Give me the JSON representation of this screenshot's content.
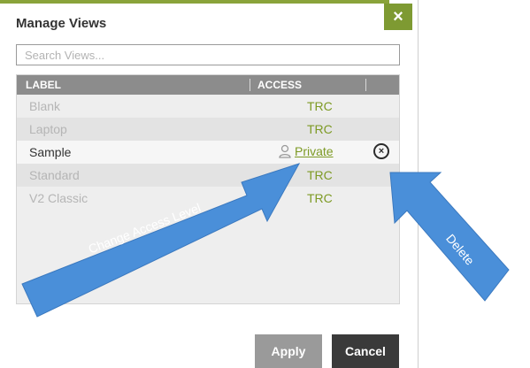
{
  "dialog": {
    "title": "Manage Views",
    "close_label": "×",
    "search_placeholder": "Search Views..."
  },
  "table": {
    "columns": [
      "LABEL",
      "ACCESS"
    ],
    "rows": [
      {
        "label": "Blank",
        "access": "TRC"
      },
      {
        "label": "Laptop",
        "access": "TRC"
      },
      {
        "label": "Sample",
        "access": "Private",
        "selected": true
      },
      {
        "label": "Standard",
        "access": "TRC"
      },
      {
        "label": "V2 Classic",
        "access": "TRC"
      }
    ]
  },
  "buttons": {
    "apply": "Apply",
    "cancel": "Cancel"
  },
  "annotations": {
    "change_access": "Change Access Level",
    "delete": "Delete"
  },
  "colors": {
    "accent_green": "#7d9a24",
    "arrow_blue": "#4a8fd9"
  },
  "icons": {
    "close": "close-icon",
    "private": "user-icon",
    "delete": "delete-circle-x-icon"
  }
}
